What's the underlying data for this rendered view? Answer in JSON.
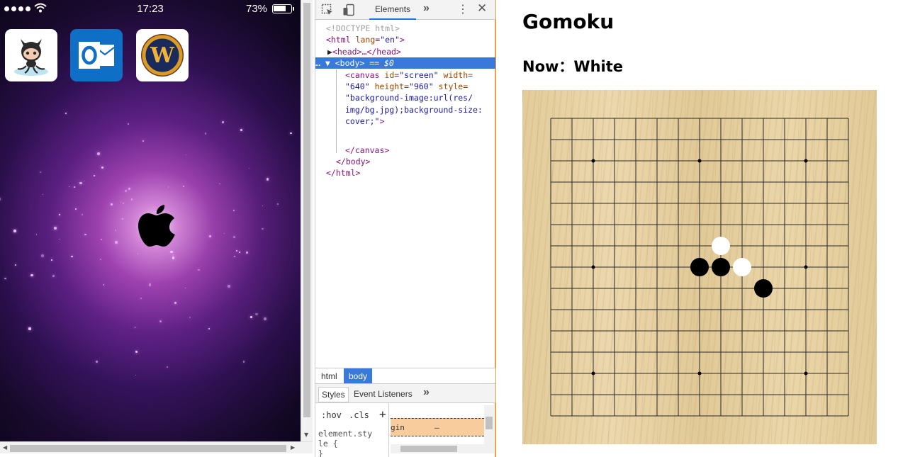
{
  "phone": {
    "status": {
      "time": "17:23",
      "battery": "73%",
      "battery_level": 0.73
    },
    "apps": [
      {
        "name": "github-app-icon"
      },
      {
        "name": "outlook-app-icon"
      },
      {
        "name": "wow-app-icon",
        "letter": "W"
      }
    ]
  },
  "devtools": {
    "tabs": {
      "elements": "Elements"
    },
    "dom": {
      "doctype": "<!DOCTYPE html>",
      "html_open_tag": "<html",
      "html_lang_attr": "lang",
      "html_lang_val": "\"en\"",
      "html_open_close": ">",
      "head": "<head>…</head>",
      "body_tag": "<body>",
      "body_hint": "== $0",
      "canvas_l1_tag": "<canvas",
      "canvas_l1_attr": "id",
      "canvas_l1_val": "\"screen\"",
      "canvas_l1_attr2": "width=",
      "canvas_l2_val": "\"640\"",
      "canvas_l2_attr": "height=",
      "canvas_l2_val2": "\"960\"",
      "canvas_l2_attr2": "style=",
      "canvas_l3": "\"background-image:url(res/",
      "canvas_l4": "img/bg.jpg);background-size:",
      "canvas_l5": "cover;\"",
      "canvas_l5_end": ">",
      "canvas_close": "</canvas>",
      "body_close": "</body>",
      "html_close": "</html>"
    },
    "breadcrumbs": [
      "html",
      "body"
    ],
    "styles_tabs": {
      "styles": "Styles",
      "listeners": "Event Listeners"
    },
    "styles_pane": {
      "hov": ":hov",
      "cls": ".cls",
      "element_style_1": "element.sty",
      "element_style_2": "le {",
      "element_style_3": "}"
    },
    "box_model": {
      "margin_label": "gin",
      "margin_value": "–"
    }
  },
  "page": {
    "title": "Gomoku",
    "now_label": "Now：",
    "now_value": "White"
  },
  "board": {
    "grid_lines": 15,
    "star_points": [
      [
        2,
        2
      ],
      [
        7,
        2
      ],
      [
        12,
        2
      ],
      [
        2,
        7
      ],
      [
        12,
        7
      ],
      [
        2,
        12
      ],
      [
        7,
        12
      ],
      [
        12,
        12
      ]
    ],
    "stones": [
      {
        "col": 8,
        "row": 6,
        "color": "white"
      },
      {
        "col": 7,
        "row": 7,
        "color": "black"
      },
      {
        "col": 8,
        "row": 7,
        "color": "black"
      },
      {
        "col": 9,
        "row": 7,
        "color": "white"
      },
      {
        "col": 10,
        "row": 8,
        "color": "black"
      }
    ],
    "colors": {
      "line": "#2a2a2a",
      "black_stone": "#000000",
      "white_stone": "#ffffff"
    }
  }
}
